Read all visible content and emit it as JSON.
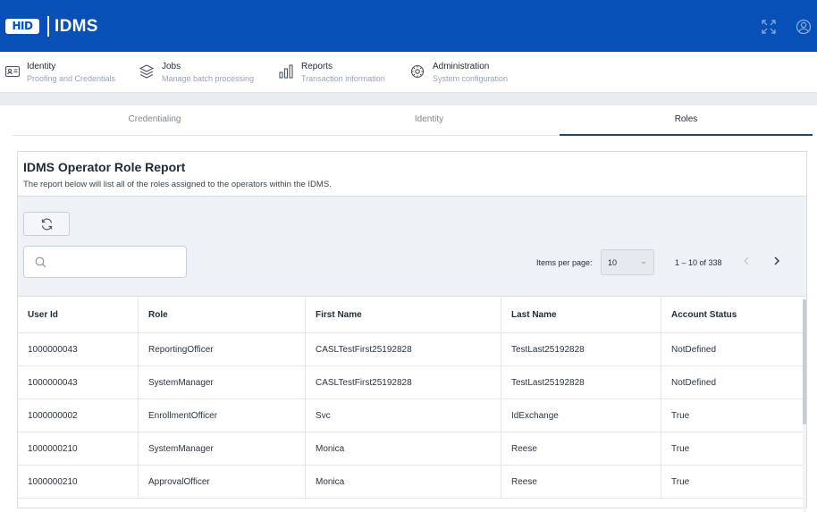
{
  "header": {
    "logo_text": "HID",
    "app_title": "IDMS",
    "icons": [
      "expand-icon",
      "user-account-icon"
    ],
    "brand_color": "#0750b8"
  },
  "nav": [
    {
      "title": "Identity",
      "subtitle": "Proofing and Credentials",
      "icon": "id-card-icon"
    },
    {
      "title": "Jobs",
      "subtitle": "Manage batch processing",
      "icon": "layers-icon"
    },
    {
      "title": "Reports",
      "subtitle": "Transaction information",
      "icon": "bar-chart-icon"
    },
    {
      "title": "Administration",
      "subtitle": "System configuration",
      "icon": "gear-icon"
    }
  ],
  "tabs": [
    {
      "label": "Credentialing",
      "active": false
    },
    {
      "label": "Identity",
      "active": false
    },
    {
      "label": "Roles",
      "active": true
    }
  ],
  "report": {
    "title": "IDMS Operator Role Report",
    "description": "The report below will list all of the roles assigned to the operators within the IDMS."
  },
  "toolbar": {
    "refresh_icon": "refresh-icon",
    "search_value": "",
    "search_icon": "search-icon"
  },
  "paginator": {
    "items_per_page_label": "Items per page:",
    "items_per_page_value": "10",
    "range_label": "1 – 10 of 338"
  },
  "table": {
    "columns": [
      "User Id",
      "Role",
      "First Name",
      "Last Name",
      "Account Status"
    ],
    "rows": [
      [
        "1000000043",
        "ReportingOfficer",
        "CASLTestFirst25192828",
        "TestLast25192828",
        "NotDefined"
      ],
      [
        "1000000043",
        "SystemManager",
        "CASLTestFirst25192828",
        "TestLast25192828",
        "NotDefined"
      ],
      [
        "1000000002",
        "EnrollmentOfficer",
        "Svc",
        "IdExchange",
        "True"
      ],
      [
        "1000000210",
        "SystemManager",
        "Monica",
        "Reese",
        "True"
      ],
      [
        "1000000210",
        "ApprovalOfficer",
        "Monica",
        "Reese",
        "True"
      ]
    ]
  }
}
